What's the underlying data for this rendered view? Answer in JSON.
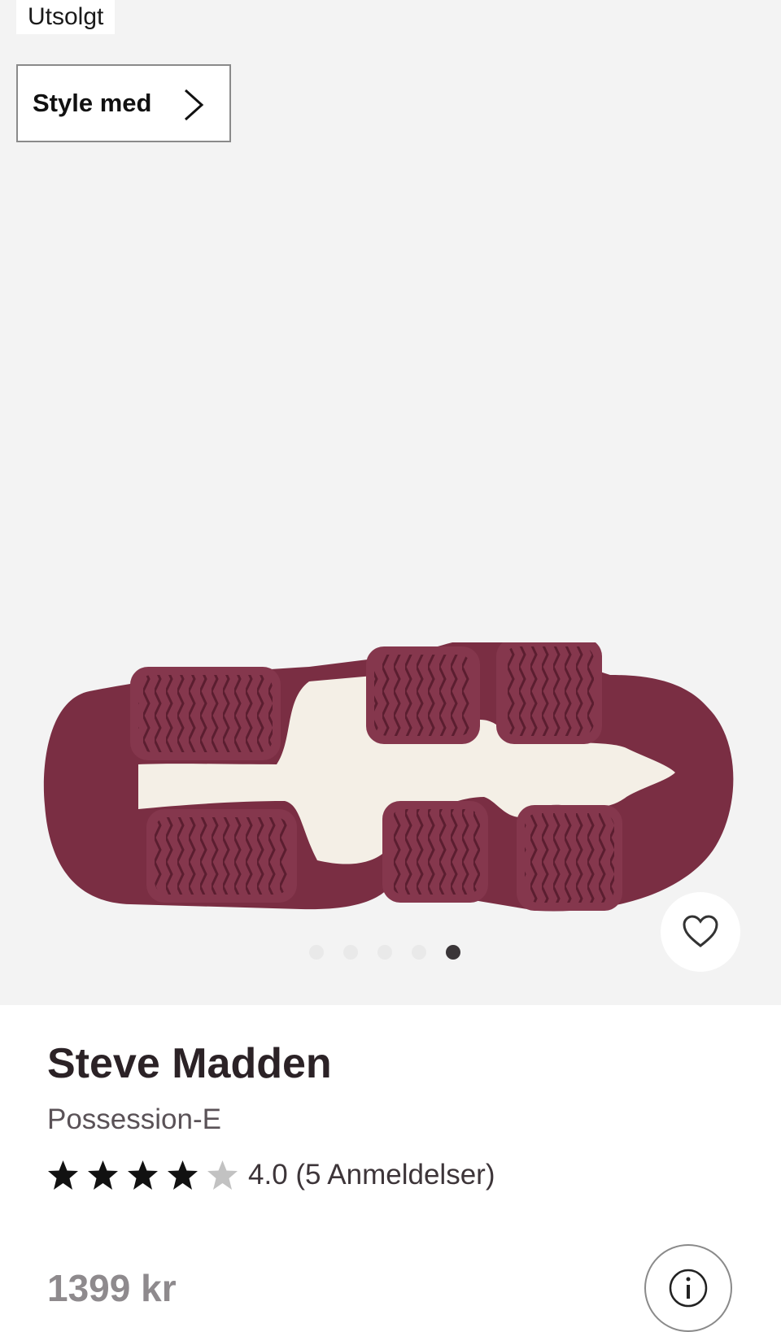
{
  "badge": {
    "sold_out": "Utsolgt"
  },
  "style_button": {
    "label": "Style med",
    "icon": "chevron-right-icon"
  },
  "gallery": {
    "total_images": 5,
    "active_index": 4
  },
  "favorite": {
    "icon": "heart-outline-icon"
  },
  "product": {
    "brand": "Steve Madden",
    "model": "Possession-E",
    "rating": {
      "value": 4,
      "max": 5,
      "text": "4.0 (5 Anmeldelser)"
    },
    "price": "1399 kr"
  },
  "info": {
    "icon": "info-icon"
  },
  "colors": {
    "sole": "#7a2e43",
    "midsole": "#f4efe6",
    "star_filled": "#111111",
    "star_empty": "#c2c2c2"
  }
}
